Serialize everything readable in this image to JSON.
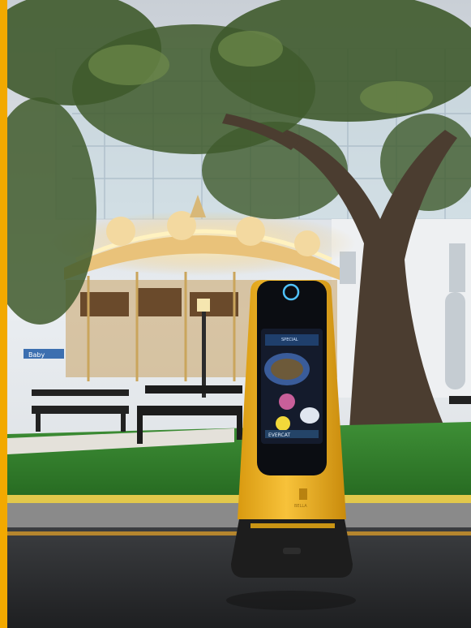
{
  "photo": {
    "alt": "",
    "robot_screen_text": [
      "SPECIAL",
      "EVERCAT"
    ],
    "robot_logo": "BELLA",
    "carousel_sign": "Baby",
    "colors": {
      "frame": "#f2a900",
      "robot_body": "#f4b71e",
      "robot_base": "#1d1d1d",
      "screen": "#0a0f1a",
      "grass": "#2f7f2c",
      "floor": "#2a2b2e",
      "carousel_light": "#ffe7a8"
    }
  }
}
